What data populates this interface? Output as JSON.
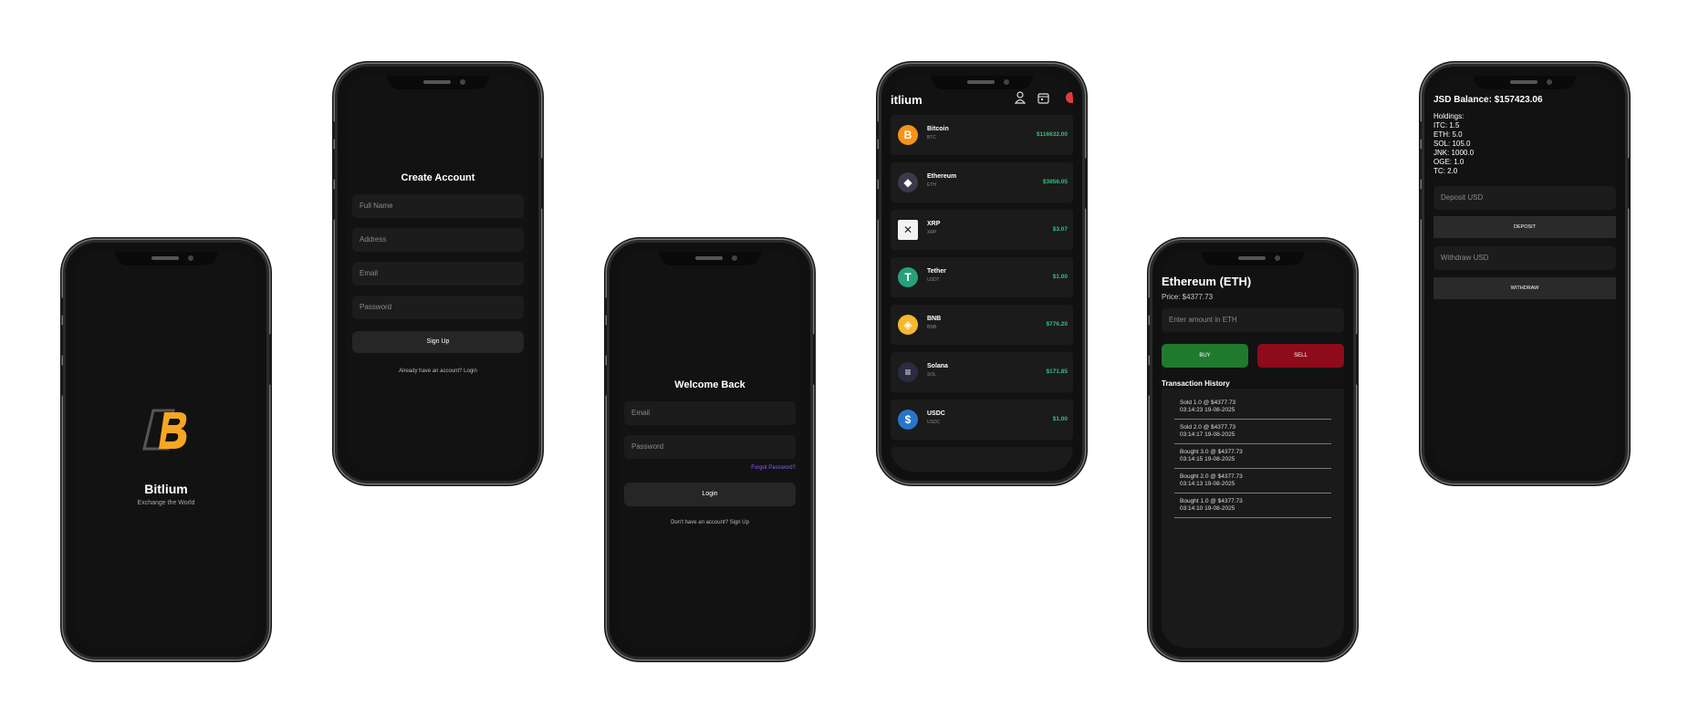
{
  "splash": {
    "app_name": "Bitlium",
    "tagline": "Exchange the World",
    "logo_letter": "B"
  },
  "signup": {
    "title": "Create Account",
    "fields": [
      "Full Name",
      "Address",
      "Email",
      "Password"
    ],
    "button": "Sign Up",
    "footer": "Already have an account? Login"
  },
  "login": {
    "title": "Welcome Back",
    "fields": [
      "Email",
      "Password"
    ],
    "forgot": "Forgot Password?",
    "button": "Login",
    "footer": "Don't have an account? Sign Up"
  },
  "markets": {
    "title": "itlium",
    "icons": [
      "user-icon",
      "calendar-icon",
      "logout-icon"
    ],
    "coins": [
      {
        "name": "Bitcoin",
        "symbol": "BTC",
        "price": "$116632.00",
        "color": "#f7931a",
        "glyph": "B"
      },
      {
        "name": "Ethereum",
        "symbol": "ETH",
        "price": "$3856.05",
        "color": "#3a3a4a",
        "glyph": "◆"
      },
      {
        "name": "XRP",
        "symbol": "XRP",
        "price": "$3.07",
        "color": "#f2f2f2",
        "glyph": "✕"
      },
      {
        "name": "Tether",
        "symbol": "USDT",
        "price": "$1.00",
        "color": "#26a17b",
        "glyph": "T"
      },
      {
        "name": "BNB",
        "symbol": "BNB",
        "price": "$776.20",
        "color": "#f3ba2f",
        "glyph": "◈"
      },
      {
        "name": "Solana",
        "symbol": "SOL",
        "price": "$171.85",
        "color": "#2b2b40",
        "glyph": "≡"
      },
      {
        "name": "USDC",
        "symbol": "USDC",
        "price": "$1.00",
        "color": "#2775ca",
        "glyph": "$"
      }
    ]
  },
  "trade": {
    "title": "Ethereum (ETH)",
    "price": "Price: $4377.73",
    "amount_placeholder": "Enter amount in ETH",
    "buy": "BUY",
    "sell": "SELL",
    "history_title": "Transaction History",
    "history": [
      {
        "line1": "Sold 1.0 @ $4377.73",
        "line2": "03:14:23 19-08-2025"
      },
      {
        "line1": "Sold 2.0 @ $4377.73",
        "line2": "03:14:17 19-08-2025"
      },
      {
        "line1": "Bought 3.0 @ $4377.73",
        "line2": "03:14:15 19-08-2025"
      },
      {
        "line1": "Bought 2.0 @ $4377.73",
        "line2": "03:14:13 19-08-2025"
      },
      {
        "line1": "Bought 1.0 @ $4377.73",
        "line2": "03:14:10 19-08-2025"
      }
    ]
  },
  "wallet": {
    "balance": "JSD Balance: $157423.06",
    "holdings_title": "Holdings:",
    "holdings": [
      "ITC: 1.5",
      "ETH: 5.0",
      "SOL: 105.0",
      "JNK: 1000.0",
      "OGE: 1.0",
      "TC: 2.0"
    ],
    "deposit_placeholder": "Deposit USD",
    "deposit_button": "DEPOSIT",
    "withdraw_placeholder": "Withdraw USD",
    "withdraw_button": "WITHDRAW"
  },
  "colors": {
    "buy": "#1f7a2e",
    "sell": "#8e0b1b",
    "accent": "#f5a623",
    "positive": "#2ec27e",
    "link": "#8b5cf6"
  }
}
